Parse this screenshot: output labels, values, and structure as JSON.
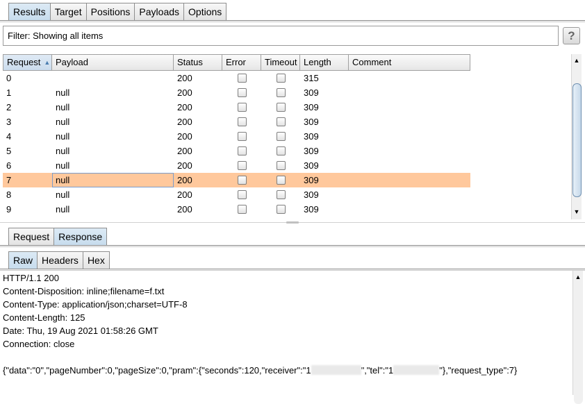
{
  "main_tabs": [
    {
      "label": "Results",
      "active": true
    },
    {
      "label": "Target",
      "active": false
    },
    {
      "label": "Positions",
      "active": false
    },
    {
      "label": "Payloads",
      "active": false
    },
    {
      "label": "Options",
      "active": false
    }
  ],
  "filter": {
    "text": "Filter: Showing all items",
    "help_label": "?"
  },
  "table": {
    "columns": [
      "Request",
      "Payload",
      "Status",
      "Error",
      "Timeout",
      "Length",
      "Comment"
    ],
    "sorted_column": "Request",
    "rows": [
      {
        "request": "0",
        "payload": "",
        "status": "200",
        "length": "315"
      },
      {
        "request": "1",
        "payload": "null",
        "status": "200",
        "length": "309"
      },
      {
        "request": "2",
        "payload": "null",
        "status": "200",
        "length": "309"
      },
      {
        "request": "3",
        "payload": "null",
        "status": "200",
        "length": "309"
      },
      {
        "request": "4",
        "payload": "null",
        "status": "200",
        "length": "309"
      },
      {
        "request": "5",
        "payload": "null",
        "status": "200",
        "length": "309"
      },
      {
        "request": "6",
        "payload": "null",
        "status": "200",
        "length": "309"
      },
      {
        "request": "7",
        "payload": "null",
        "status": "200",
        "length": "309"
      },
      {
        "request": "8",
        "payload": "null",
        "status": "200",
        "length": "309"
      },
      {
        "request": "9",
        "payload": "null",
        "status": "200",
        "length": "309"
      }
    ],
    "selected_row": "7",
    "selected_color": "#ffc89c"
  },
  "reqres_tabs": [
    {
      "label": "Request",
      "active": false
    },
    {
      "label": "Response",
      "active": true
    }
  ],
  "view_tabs": [
    {
      "label": "Raw",
      "active": true
    },
    {
      "label": "Headers",
      "active": false
    },
    {
      "label": "Hex",
      "active": false
    }
  ],
  "response": {
    "headers": [
      "HTTP/1.1 200",
      "Content-Disposition: inline;filename=f.txt",
      "Content-Type: application/json;charset=UTF-8",
      "Content-Length: 125",
      "Date: Thu, 19 Aug 2021 01:58:26 GMT",
      "Connection: close"
    ],
    "body_part1": "{\"data\":\"0\",\"pageNumber\":0,\"pageSize\":0,\"pram\":{\"seconds\":120,\"receiver\":\"1",
    "body_part2": "\",\"tel\":\"1",
    "body_part3": "\"},\"request_type\":7}"
  }
}
